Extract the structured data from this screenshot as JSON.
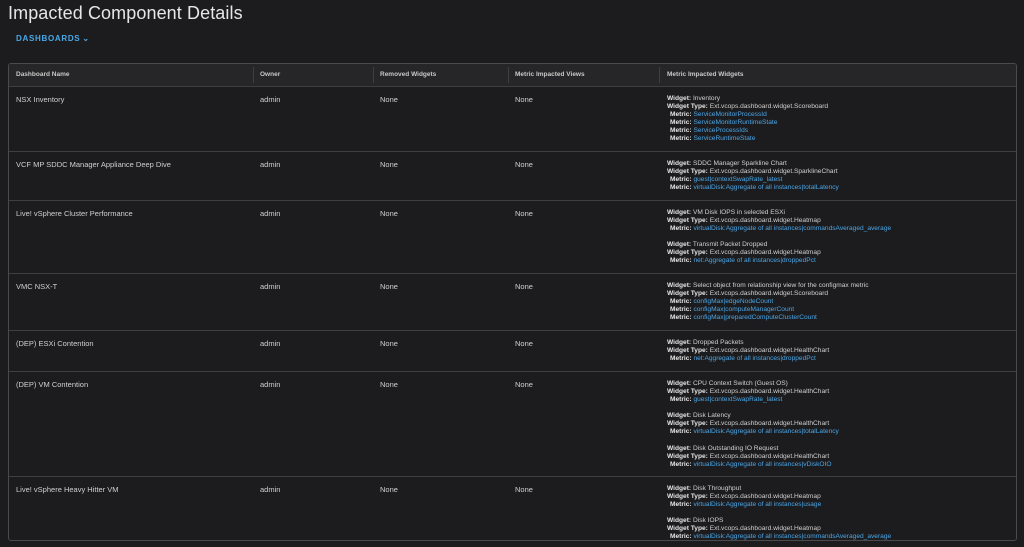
{
  "page": {
    "title": "Impacted Component Details",
    "dashboards_link": "DASHBOARDS",
    "chevron": "⌄"
  },
  "labels": {
    "widget": "Widget:",
    "widget_type": "Widget Type:",
    "metric": "Metric:"
  },
  "columns": [
    "Dashboard Name",
    "Owner",
    "Removed Widgets",
    "Metric Impacted Views",
    "Metric Impacted Widgets"
  ],
  "rows": [
    {
      "name": "NSX Inventory",
      "owner": "admin",
      "removed": "None",
      "views": "None",
      "widgets": [
        {
          "widget": "Inventory",
          "type": "Ext.vcops.dashboard.widget.Scoreboard",
          "metrics": [
            "ServiceMonitorProcessId",
            "ServiceMonitorRuntimeState",
            "ServiceProcessIds",
            "ServiceRuntimeState"
          ]
        }
      ]
    },
    {
      "name": "VCF MP SDDC Manager Appliance Deep Dive",
      "owner": "admin",
      "removed": "None",
      "views": "None",
      "widgets": [
        {
          "widget": "SDDC Manager Sparkline Chart",
          "type": "Ext.vcops.dashboard.widget.SparklineChart",
          "metrics": [
            "guest|contextSwapRate_latest",
            "virtualDisk:Aggregate of all instances|totalLatency"
          ]
        }
      ]
    },
    {
      "name": "Live! vSphere Cluster Performance",
      "owner": "admin",
      "removed": "None",
      "views": "None",
      "widgets": [
        {
          "widget": "VM Disk IOPS in selected ESXi",
          "type": "Ext.vcops.dashboard.widget.Heatmap",
          "metrics": [
            "virtualDisk:Aggregate of all instances|commandsAveraged_average"
          ]
        },
        {
          "widget": "Transmit Packet Dropped",
          "type": "Ext.vcops.dashboard.widget.Heatmap",
          "metrics": [
            "net:Aggregate of all instances|droppedPct"
          ]
        }
      ]
    },
    {
      "name": "VMC NSX-T",
      "owner": "admin",
      "removed": "None",
      "views": "None",
      "widgets": [
        {
          "widget": "Select object from relationship view for the configmax metric",
          "type": "Ext.vcops.dashboard.widget.Scoreboard",
          "metrics": [
            "configMax|edgeNodeCount",
            "configMax|computeManagerCount",
            "configMax|preparedComputeClusterCount"
          ]
        }
      ]
    },
    {
      "name": "(DEP) ESXi Contention",
      "owner": "admin",
      "removed": "None",
      "views": "None",
      "widgets": [
        {
          "widget": "Dropped Packets",
          "type": "Ext.vcops.dashboard.widget.HealthChart",
          "metrics": [
            "net:Aggregate of all instances|droppedPct"
          ]
        }
      ]
    },
    {
      "name": "(DEP) VM Contention",
      "owner": "admin",
      "removed": "None",
      "views": "None",
      "widgets": [
        {
          "widget": "CPU Context Switch (Guest OS)",
          "type": "Ext.vcops.dashboard.widget.HealthChart",
          "metrics": [
            "guest|contextSwapRate_latest"
          ]
        },
        {
          "widget": "Disk Latency",
          "type": "Ext.vcops.dashboard.widget.HealthChart",
          "metrics": [
            "virtualDisk:Aggregate of all instances|totalLatency"
          ]
        },
        {
          "widget": "Disk Outstanding IO Request",
          "type": "Ext.vcops.dashboard.widget.HealthChart",
          "metrics": [
            "virtualDisk:Aggregate of all instances|vDiskOIO"
          ]
        }
      ]
    },
    {
      "name": "Live! vSphere Heavy Hitter VM",
      "owner": "admin",
      "removed": "None",
      "views": "None",
      "widgets": [
        {
          "widget": "Disk Throughput",
          "type": "Ext.vcops.dashboard.widget.Heatmap",
          "metrics": [
            "virtualDisk:Aggregate of all instances|usage"
          ]
        },
        {
          "widget": "Disk IOPS",
          "type": "Ext.vcops.dashboard.widget.Heatmap",
          "metrics": [
            "virtualDisk:Aggregate of all instances|commandsAveraged_average"
          ]
        }
      ]
    }
  ]
}
